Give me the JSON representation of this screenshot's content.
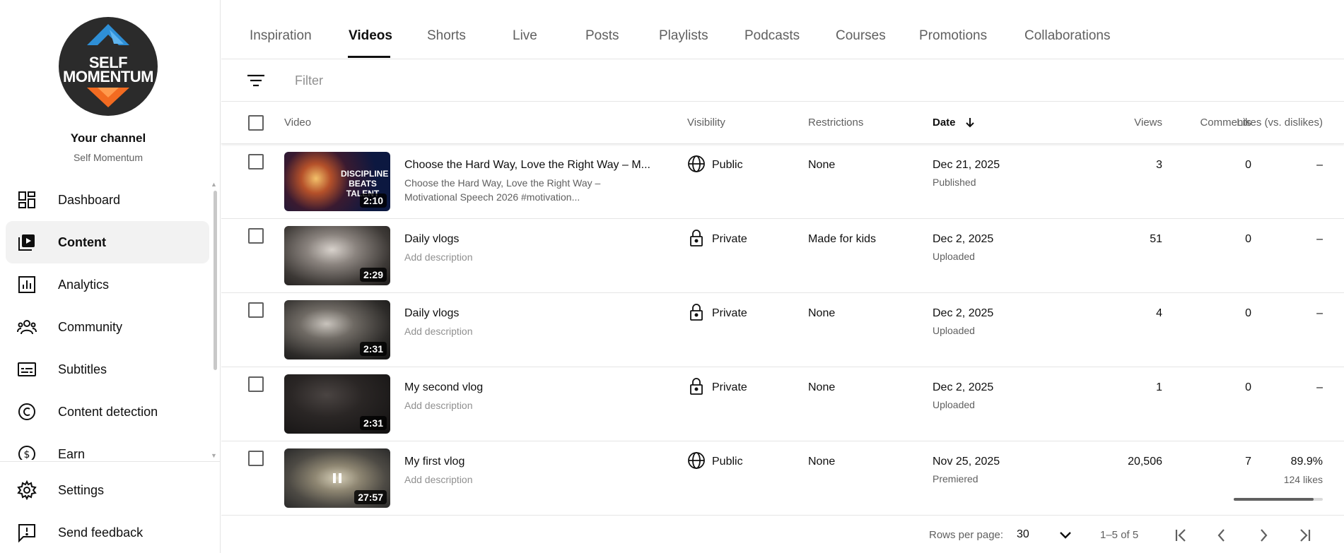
{
  "channel": {
    "logo_line1": "SELF",
    "logo_line2": "MOMENTUM",
    "title": "Your channel",
    "name": "Self Momentum"
  },
  "sidebar": {
    "items": [
      {
        "label": "Dashboard",
        "icon": "dashboard-icon"
      },
      {
        "label": "Content",
        "icon": "content-icon",
        "active": true
      },
      {
        "label": "Analytics",
        "icon": "analytics-icon"
      },
      {
        "label": "Community",
        "icon": "community-icon"
      },
      {
        "label": "Subtitles",
        "icon": "subtitles-icon"
      },
      {
        "label": "Content detection",
        "icon": "copyright-icon"
      },
      {
        "label": "Earn",
        "icon": "earn-icon"
      }
    ],
    "settings_label": "Settings",
    "feedback_label": "Send feedback"
  },
  "tabs": [
    "Inspiration",
    "Videos",
    "Shorts",
    "Live",
    "Posts",
    "Playlists",
    "Podcasts",
    "Courses",
    "Promotions",
    "Collaborations"
  ],
  "active_tab": "Videos",
  "filter": {
    "placeholder": "Filter"
  },
  "table": {
    "headers": {
      "video": "Video",
      "visibility": "Visibility",
      "restrictions": "Restrictions",
      "date": "Date",
      "views": "Views",
      "comments": "Comments",
      "likes": "Likes (vs. dislikes)"
    },
    "rows": [
      {
        "title": "Choose the Hard Way, Love the Right Way – M...",
        "description": "Choose the Hard Way, Love the Right Way – Motivational Speech 2026 #motivation...",
        "duration": "2:10",
        "thumb_text": "DISCIPLINE BEATS TALENT",
        "visibility": "Public",
        "visibility_icon": "globe-icon",
        "restrictions": "None",
        "date": "Dec 21, 2025",
        "date_status": "Published",
        "views": "3",
        "comments": "0",
        "likes": "–"
      },
      {
        "title": "Daily vlogs",
        "description": "Add description",
        "duration": "2:29",
        "visibility": "Private",
        "visibility_icon": "lock-icon",
        "restrictions": "Made for kids",
        "date": "Dec 2, 2025",
        "date_status": "Uploaded",
        "views": "51",
        "comments": "0",
        "likes": "–"
      },
      {
        "title": "Daily vlogs",
        "description": "Add description",
        "duration": "2:31",
        "visibility": "Private",
        "visibility_icon": "lock-icon",
        "restrictions": "None",
        "date": "Dec 2, 2025",
        "date_status": "Uploaded",
        "views": "4",
        "comments": "0",
        "likes": "–"
      },
      {
        "title": "My second vlog",
        "description": "Add description",
        "duration": "2:31",
        "visibility": "Private",
        "visibility_icon": "lock-icon",
        "restrictions": "None",
        "date": "Dec 2, 2025",
        "date_status": "Uploaded",
        "views": "1",
        "comments": "0",
        "likes": "–"
      },
      {
        "title": "My first vlog",
        "description": "Add description",
        "duration": "27:57",
        "visibility": "Public",
        "visibility_icon": "globe-icon",
        "restrictions": "None",
        "date": "Nov 25, 2025",
        "date_status": "Premiered",
        "views": "20,506",
        "comments": "7",
        "likes": "89.9%",
        "likes_count": "124 likes",
        "likes_ratio": 0.899
      }
    ]
  },
  "pagination": {
    "rows_per_page_label": "Rows per page:",
    "rows_per_page": "30",
    "range": "1–5 of 5"
  },
  "colors": {
    "accent": "#0f0f0f",
    "muted_text": "#606060",
    "divider": "#e5e5e5",
    "logo_orange": "#f26b21",
    "logo_blue": "#2e8fd6"
  }
}
